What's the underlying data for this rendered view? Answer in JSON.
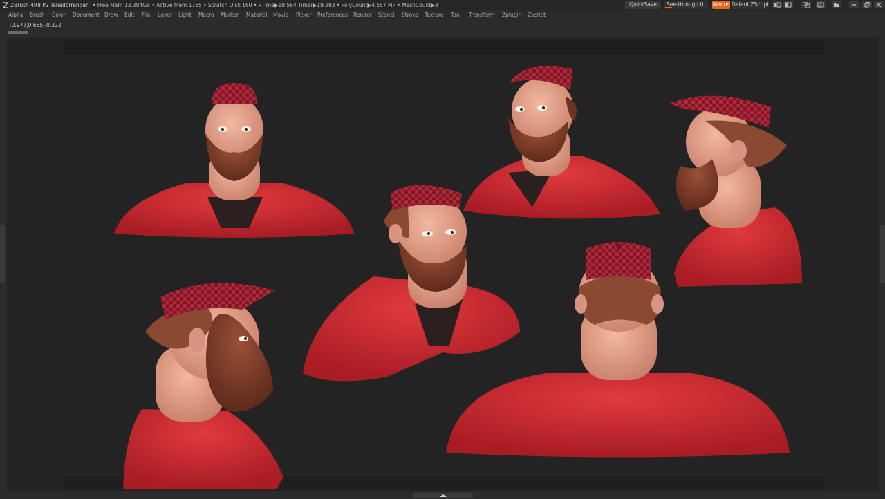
{
  "titlebar": {
    "app": "ZBrush 4R8 P2",
    "project": "leñadorrender",
    "stats": "• Free Mem 13.384GB • Active Mem 1765 • Scratch Disk 160 •  RTime▶19.564 Timer▶19.293 • PolyCount▶4.557 MP • MeshCount▶8",
    "quicksave": "QuickSave",
    "see_through": "See-through  0",
    "menus": "Menus",
    "default_zscript": "DefaultZScript"
  },
  "menubar": {
    "items": [
      "Alpha",
      "Brush",
      "Color",
      "Document",
      "Draw",
      "Edit",
      "File",
      "Layer",
      "Light",
      "Macro",
      "Marker",
      "Material",
      "Movie",
      "Picker",
      "Preferences",
      "Render",
      "Stencil",
      "Stroke",
      "Texture",
      "Tool",
      "Transform",
      "Zplugin",
      "Zscript"
    ]
  },
  "status": {
    "coords": "-0.977,0.665,-0.322"
  },
  "colors": {
    "accent": "#e06a1e",
    "shirt": "#c4282e",
    "skin": "#e9a690",
    "beard": "#7a3a28",
    "background": "#232323"
  },
  "icons": {
    "app": "zbrush-logo-icon",
    "seethrough_slider": "slider-icon",
    "window_controls": [
      "layout-icon",
      "layout-icon",
      "layout-icon",
      "layout-icon",
      "folder-icon",
      "minimize-icon",
      "restore-icon",
      "close-icon"
    ]
  }
}
